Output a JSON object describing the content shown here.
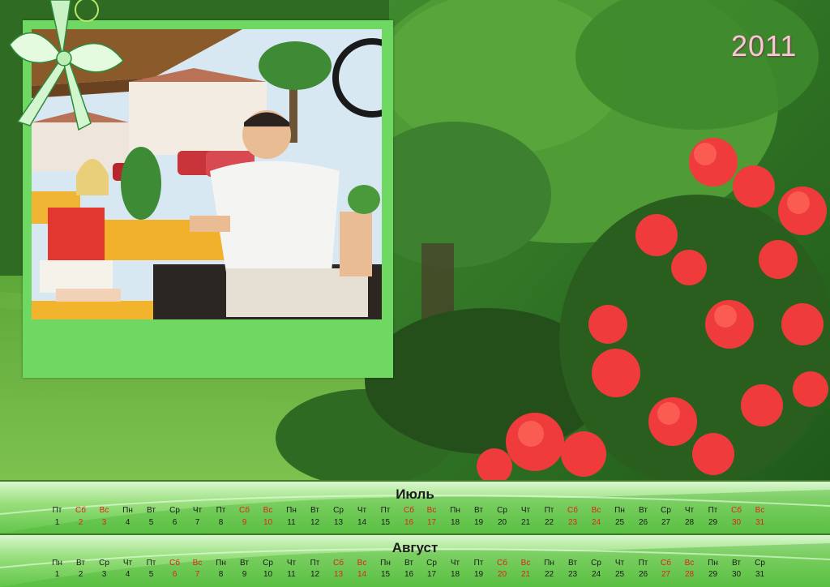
{
  "year": "2011",
  "months": [
    {
      "name": "Июль",
      "weekdays": [
        "Пт",
        "Сб",
        "Вс",
        "Пн",
        "Вт",
        "Ср",
        "Чт",
        "Пт",
        "Сб",
        "Вс",
        "Пн",
        "Вт",
        "Ср",
        "Чт",
        "Пт",
        "Сб",
        "Вс",
        "Пн",
        "Вт",
        "Ср",
        "Чт",
        "Пт",
        "Сб",
        "Вс",
        "Пн",
        "Вт",
        "Ср",
        "Чт",
        "Пт",
        "Сб",
        "Вс"
      ],
      "days": [
        "1",
        "2",
        "3",
        "4",
        "5",
        "6",
        "7",
        "8",
        "9",
        "10",
        "11",
        "12",
        "13",
        "14",
        "15",
        "16",
        "17",
        "18",
        "19",
        "20",
        "21",
        "22",
        "23",
        "24",
        "25",
        "26",
        "27",
        "28",
        "29",
        "30",
        "31"
      ],
      "weekend": [
        false,
        true,
        true,
        false,
        false,
        false,
        false,
        false,
        true,
        true,
        false,
        false,
        false,
        false,
        false,
        true,
        true,
        false,
        false,
        false,
        false,
        false,
        true,
        true,
        false,
        false,
        false,
        false,
        false,
        true,
        true
      ]
    },
    {
      "name": "Август",
      "weekdays": [
        "Пн",
        "Вт",
        "Ср",
        "Чт",
        "Пт",
        "Сб",
        "Вс",
        "Пн",
        "Вт",
        "Ср",
        "Чт",
        "Пт",
        "Сб",
        "Вс",
        "Пн",
        "Вт",
        "Ср",
        "Чт",
        "Пт",
        "Сб",
        "Вс",
        "Пн",
        "Вт",
        "Ср",
        "Чт",
        "Пт",
        "Сб",
        "Вс",
        "Пн",
        "Вт",
        "Ср"
      ],
      "days": [
        "1",
        "2",
        "3",
        "4",
        "5",
        "6",
        "7",
        "8",
        "9",
        "10",
        "11",
        "12",
        "13",
        "14",
        "15",
        "16",
        "17",
        "18",
        "19",
        "20",
        "21",
        "22",
        "23",
        "24",
        "25",
        "26",
        "27",
        "28",
        "29",
        "30",
        "31"
      ],
      "weekend": [
        false,
        false,
        false,
        false,
        false,
        true,
        true,
        false,
        false,
        false,
        false,
        false,
        true,
        true,
        false,
        false,
        false,
        false,
        false,
        true,
        true,
        false,
        false,
        false,
        false,
        false,
        true,
        true,
        false,
        false,
        false
      ]
    }
  ],
  "colors": {
    "weekend": "#e0231c",
    "weekday": "#1a1a1a",
    "frame": "#6fd863",
    "year": "#f3c9d2"
  },
  "icons": [
    "ribbon-bow-icon"
  ]
}
